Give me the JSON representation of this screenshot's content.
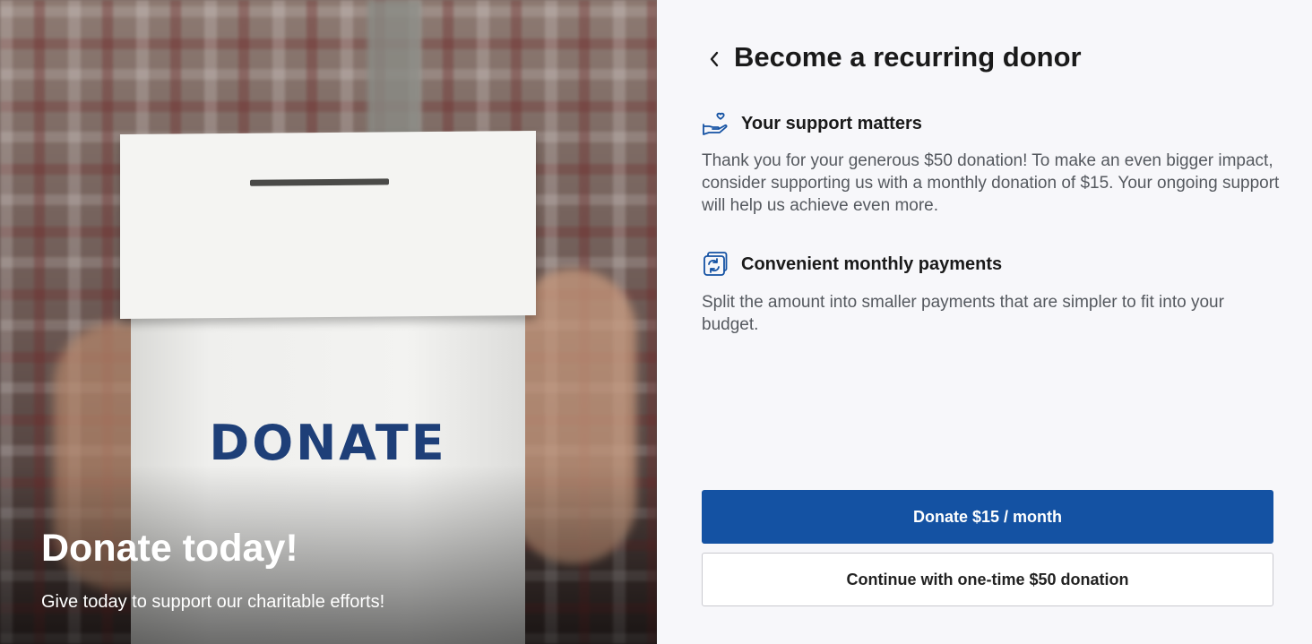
{
  "hero": {
    "box_label": "DONATE",
    "title": "Donate today!",
    "subtitle": "Give today to support our charitable efforts!"
  },
  "panel": {
    "title": "Become a recurring donor",
    "features": [
      {
        "icon": "hand-heart-icon",
        "title": "Your support matters",
        "text": "Thank you for your generous $50 donation! To make an even bigger impact, consider supporting us with a monthly donation of $15. Your ongoing support will help us achieve even more."
      },
      {
        "icon": "recurring-payment-icon",
        "title": "Convenient monthly payments",
        "text": "Split the amount into smaller payments that are simpler to fit into your budget."
      }
    ],
    "primary_button": "Donate $15 / month",
    "secondary_button": "Continue with one-time $50 donation"
  },
  "colors": {
    "accent": "#1452a3",
    "icon": "#1452a3",
    "panel_bg": "#f7f7fa",
    "body_text": "#55595f"
  }
}
